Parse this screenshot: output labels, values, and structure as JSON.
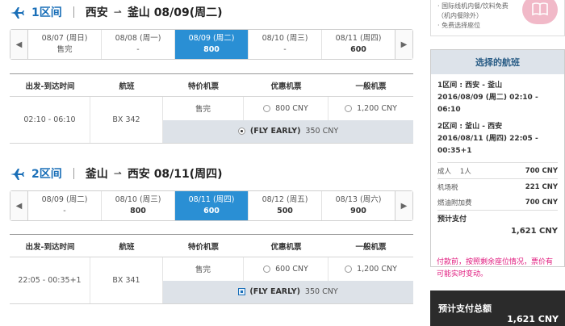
{
  "segments": [
    {
      "label": "1区间",
      "from": "西安",
      "to": "釜山",
      "date": "08/09(周二)",
      "dates": [
        {
          "date": "08/07 (周日)",
          "price": "售完"
        },
        {
          "date": "08/08 (周一)",
          "price": "-"
        },
        {
          "date": "08/09 (周二)",
          "price": "800"
        },
        {
          "date": "08/10 (周三)",
          "price": "-"
        },
        {
          "date": "08/11 (周四)",
          "price": "600"
        }
      ],
      "table_headers": [
        "出发-到达时间",
        "航班",
        "特价机票",
        "优惠机票",
        "一般机票"
      ],
      "time": "02:10 - 06:10",
      "flight": "BX 342",
      "special": "售完",
      "discount": "800 CNY",
      "normal": "1,200 CNY",
      "fly_early_tag": "(FLY EARLY)",
      "fly_early_price": "350 CNY"
    },
    {
      "label": "2区间",
      "from": "釜山",
      "to": "西安",
      "date": "08/11(周四)",
      "dates": [
        {
          "date": "08/09 (周二)",
          "price": "-"
        },
        {
          "date": "08/10 (周三)",
          "price": "800"
        },
        {
          "date": "08/11 (周四)",
          "price": "600"
        },
        {
          "date": "08/12 (周五)",
          "price": "500"
        },
        {
          "date": "08/13 (周六)",
          "price": "900"
        }
      ],
      "table_headers": [
        "出发-到达时间",
        "航班",
        "特价机票",
        "优惠机票",
        "一般机票"
      ],
      "time": "22:05 - 00:35+1",
      "flight": "BX 341",
      "special": "售完",
      "discount": "600 CNY",
      "normal": "1,200 CNY",
      "fly_early_tag": "(FLY EARLY)",
      "fly_early_price": "350 CNY"
    }
  ],
  "sidebar": {
    "top_lines": [
      "· 国际线机内餐/饮料免费",
      "（机内餐除外）",
      "· 免费选择座位"
    ],
    "title": "选择的航班",
    "seg1_line1": "1区间 : 西安 - 釜山",
    "seg1_line2": "2016/08/09 (周二) 02:10 - 06:10",
    "seg2_line1": "2区间 : 釜山 - 西安",
    "seg2_line2": "2016/08/11 (周四) 22:05 -",
    "seg2_line3": "00:35+1",
    "adult_label": "成人",
    "adult_count": "1人",
    "adult_price": "700 CNY",
    "tax_label": "机场税",
    "tax_price": "221 CNY",
    "fuel_label": "燃油附加费",
    "fuel_price": "700 CNY",
    "pay_label": "预计支付",
    "pay_amount": "1,621 CNY",
    "notice": "付款前，按照剩余座位情况，票价有可能实时变动。",
    "total_label": "预计支付总额",
    "total_amount": "1,621 CNY"
  },
  "colors": {
    "accent": "#2a8fd4",
    "brand": "#1a6fb8",
    "pink": "#e0197d"
  }
}
